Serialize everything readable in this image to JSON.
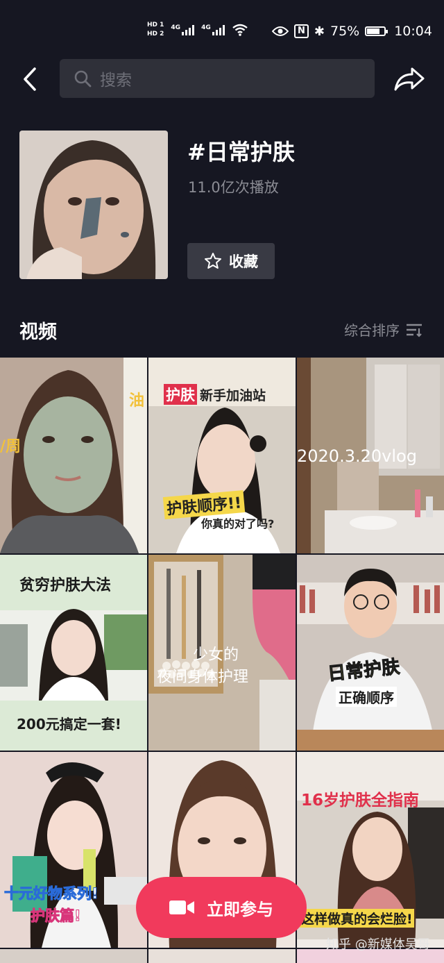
{
  "status_bar": {
    "hd1": "HD 1",
    "hd2": "HD 2",
    "net1": "4G",
    "net2": "4G",
    "nfc": "N",
    "bluetooth": "✱",
    "battery_pct": "75%",
    "battery_level": 0.75,
    "time": "10:04"
  },
  "search": {
    "placeholder": "搜索"
  },
  "topic": {
    "title": "#日常护肤",
    "plays": "11.0亿次播放",
    "favorite_label": "收藏"
  },
  "videos_section": {
    "title": "视频",
    "sort_label": "综合排序"
  },
  "videos": [
    {
      "captions": [
        "油",
        "/周"
      ]
    },
    {
      "captions": [
        "护肤",
        "新手加油站",
        "护肤顺序!!",
        "你真的对了吗?"
      ]
    },
    {
      "captions": [
        "2020.3.20vlog"
      ]
    },
    {
      "captions": [
        "贫穷护肤大法",
        "200元搞定一套!"
      ]
    },
    {
      "captions": [
        "少女的",
        "夜间身体护理"
      ]
    },
    {
      "captions": [
        "日常护肤",
        "正确顺序"
      ]
    },
    {
      "captions": [
        "十元好物系列!",
        "护肤篇!"
      ]
    },
    {
      "captions": []
    },
    {
      "captions": [
        "16岁护肤全指南",
        "这样做真的会烂脸!"
      ]
    }
  ],
  "join_button": {
    "label": "立即参与"
  },
  "watermark": "知乎 @新媒体吴哥",
  "colors": {
    "accent": "#f13a5c",
    "background": "#161722"
  }
}
